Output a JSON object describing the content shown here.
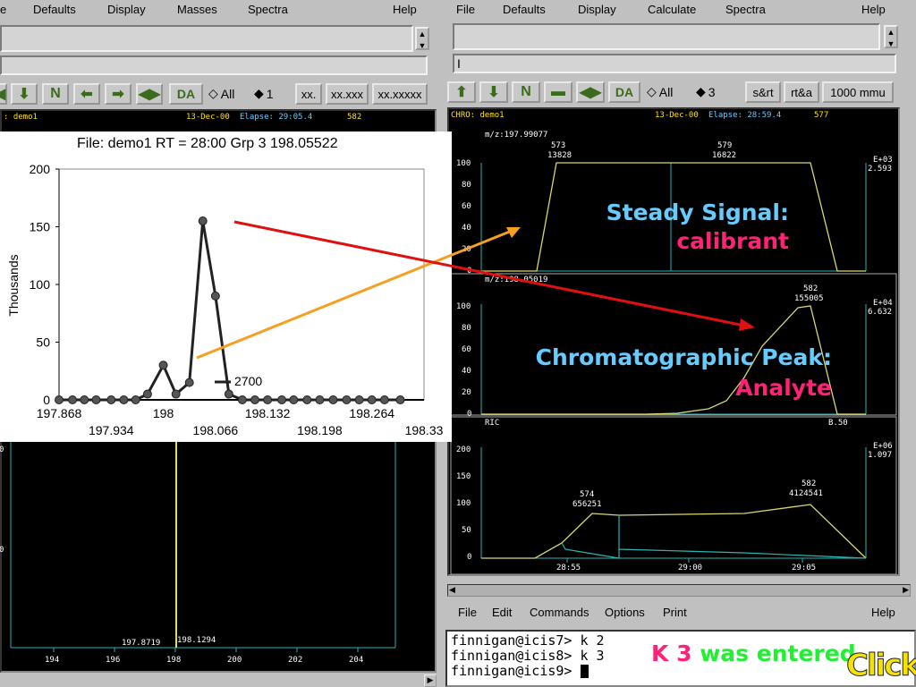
{
  "left_window": {
    "menu": [
      {
        "label": "Defaults",
        "u": "D"
      },
      {
        "label": "Display",
        "u": "D"
      },
      {
        "label": "Masses",
        "u": "M"
      },
      {
        "label": "Spectra",
        "u": "S"
      },
      {
        "label": "Help",
        "u": "H"
      }
    ],
    "menu_first_fragment": "e",
    "radio_all": "All",
    "radio_one": "1",
    "btn_da": "DA",
    "btn_fmt1": "xx.",
    "btn_fmt2": "xx.xxx",
    "btn_fmt3": "xx.xxxxx",
    "header_file": ": demo1",
    "header_date": "13-Dec-00",
    "header_elapse": "Elapse: 29:05.4",
    "header_scan": "582",
    "peak_labels": [
      "197.8719",
      "198.1294"
    ],
    "x_ticks": [
      "194",
      "196",
      "198",
      "200",
      "202",
      "204"
    ],
    "yfrag1": "0",
    "yfrag2": "0"
  },
  "right_window": {
    "menu": [
      {
        "label": "File",
        "u": "F"
      },
      {
        "label": "Defaults",
        "u": "D"
      },
      {
        "label": "Display",
        "u": "D"
      },
      {
        "label": "Calculate",
        "u": "C"
      },
      {
        "label": "Spectra",
        "u": "S"
      },
      {
        "label": "Help",
        "u": "H"
      }
    ],
    "radio_all": "All",
    "radio_three": "3",
    "btn_da": "DA",
    "btn_srt": "s&rt",
    "btn_rta": "rt&a",
    "btn_mmu": "1000 mmu",
    "header_file": "CHRO: demo1",
    "header_date": "13-Dec-00",
    "header_elapse": "Elapse: 28:59.4",
    "header_scan": "577",
    "panel1": {
      "mz": "m/z:197.99077",
      "ann1_scan": "573",
      "ann1_val": "13828",
      "ann2_scan": "579",
      "ann2_val": "16822",
      "exp": "E+03",
      "exp_val": "2.593",
      "yticks": [
        "100",
        "80",
        "60",
        "40",
        "20",
        "0"
      ]
    },
    "panel2": {
      "mz": "m/z:198.05019",
      "ann_scan": "582",
      "ann_val": "155005",
      "exp": "E+04",
      "exp_val": "6.632",
      "yticks": [
        "100",
        "80",
        "60",
        "40",
        "20",
        "0"
      ]
    },
    "panel3": {
      "label": "RIC",
      "blabel": "B.50",
      "ann1_scan": "574",
      "ann1_val": "656251",
      "ann2_scan": "582",
      "ann2_val": "4124541",
      "exp": "E+06",
      "exp_val": "1.097",
      "yticks": [
        "200",
        "150",
        "100",
        "50",
        "0"
      ],
      "xticks": [
        "28:55",
        "29:00",
        "29:05"
      ]
    }
  },
  "terminal_window": {
    "menu": [
      {
        "label": "File",
        "u": "F"
      },
      {
        "label": "Edit",
        "u": "E"
      },
      {
        "label": "Commands",
        "u": "C"
      },
      {
        "label": "Options",
        "u": "O"
      },
      {
        "label": "Print",
        "u": "P"
      },
      {
        "label": "Help",
        "u": "H"
      }
    ],
    "lines": [
      "finnigan@icis7> k 2",
      "finnigan@icis8> k 3",
      "finnigan@icis9> "
    ]
  },
  "inset_chart": {
    "title": "File:  demo1  RT = 28:00  Grp 3     198.05522",
    "ylabel": "Thousands",
    "yticks": [
      "200",
      "150",
      "100",
      "50",
      "0"
    ],
    "xticks_top": [
      "197.868",
      "198",
      "198.132",
      "198.264"
    ],
    "xticks_bottom": [
      "197.934",
      "198.066",
      "198.198",
      "198.33"
    ],
    "marker": "2700"
  },
  "annotations": {
    "steady_title": "Steady Signal:",
    "steady_sub": "calibrant",
    "chrom_title": "Chromatographic Peak:",
    "chrom_sub": "Analyte",
    "entered_k": "K 3",
    "entered_rest": "was entered",
    "click": "Click",
    "colors": {
      "blue": "#66ccff",
      "pink": "#ff2277",
      "green": "#22ee33",
      "orange": "#f5a020",
      "red": "#e01010",
      "trace": "#d8d870"
    }
  },
  "chart_data": [
    {
      "type": "line",
      "title": "File:  demo1  RT = 28:00  Grp 3     198.05522",
      "ylabel": "Thousands",
      "x": [
        197.868,
        197.885,
        197.9,
        197.915,
        197.934,
        197.95,
        197.965,
        197.98,
        198.0,
        198.016,
        198.033,
        198.05,
        198.066,
        198.083,
        198.1,
        198.116,
        198.132,
        198.15,
        198.165,
        198.182,
        198.198,
        198.215,
        198.232,
        198.248,
        198.264,
        198.28,
        198.3
      ],
      "series": [
        {
          "values": [
            0,
            0,
            0,
            0,
            0,
            0,
            0,
            5,
            30,
            5,
            15,
            155,
            90,
            5,
            0,
            0,
            0,
            0,
            0,
            0,
            0,
            0,
            0,
            0,
            0,
            0,
            0
          ]
        }
      ],
      "ylim": [
        0,
        200
      ]
    },
    {
      "type": "line",
      "ylim": [
        0,
        100
      ],
      "series": [
        {
          "values": [
            0,
            0,
            100,
            100,
            100,
            100,
            100,
            100,
            0,
            0
          ]
        }
      ],
      "x": [
        28.52,
        28.53,
        28.54,
        28.55,
        28.57,
        28.59,
        29.0,
        29.03,
        29.06,
        29.08
      ]
    },
    {
      "type": "line",
      "ylim": [
        0,
        100
      ],
      "series": [
        {
          "values": [
            0,
            0,
            0,
            0,
            0,
            1,
            2,
            4,
            8,
            20,
            45,
            70,
            100,
            0
          ]
        }
      ],
      "x": [
        28.52,
        28.53,
        28.55,
        28.57,
        28.59,
        29.0,
        29.01,
        29.02,
        29.03,
        29.04,
        29.05,
        29.06,
        29.065,
        29.08
      ]
    }
  ]
}
